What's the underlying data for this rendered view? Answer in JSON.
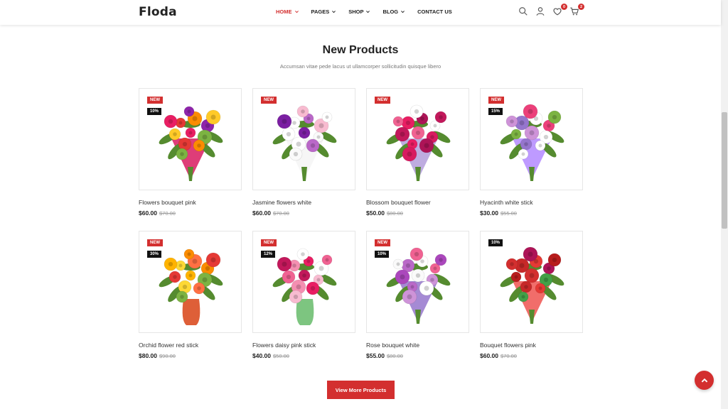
{
  "header": {
    "logo": "Floda",
    "nav": [
      {
        "label": "HOME",
        "active": true,
        "dropdown": true
      },
      {
        "label": "PAGES",
        "active": false,
        "dropdown": true
      },
      {
        "label": "SHOP",
        "active": false,
        "dropdown": true
      },
      {
        "label": "BLOG",
        "active": false,
        "dropdown": true
      },
      {
        "label": "CONTACT US",
        "active": false,
        "dropdown": false
      }
    ],
    "icons": [
      "search-icon",
      "user-icon",
      "heart-icon",
      "cart-icon"
    ],
    "wishlist_count": "0",
    "cart_count": "2"
  },
  "section": {
    "title": "New Products",
    "subtitle": "Accumsan vitae pede lacus ut ullamcorper sollicitudin quisque libero"
  },
  "products": [
    {
      "name": "Flowers bouquet pink",
      "price": "$60.00",
      "old_price": "$70.00",
      "new_tag": "NEW",
      "discount": "10%"
    },
    {
      "name": "Jasmine flowers white",
      "price": "$60.00",
      "old_price": "$70.00",
      "new_tag": "NEW",
      "discount": ""
    },
    {
      "name": "Blossom bouquet flower",
      "price": "$50.00",
      "old_price": "$80.00",
      "new_tag": "NEW",
      "discount": ""
    },
    {
      "name": "Hyacinth white stick",
      "price": "$30.00",
      "old_price": "$55.00",
      "new_tag": "NEW",
      "discount": "15%"
    },
    {
      "name": "Orchid flower red stick",
      "price": "$80.00",
      "old_price": "$90.00",
      "new_tag": "NEW",
      "discount": "30%"
    },
    {
      "name": "Flowers daisy pink stick",
      "price": "$40.00",
      "old_price": "$50.00",
      "new_tag": "NEW",
      "discount": "12%"
    },
    {
      "name": "Rose bouquet white",
      "price": "$55.00",
      "old_price": "$80.00",
      "new_tag": "NEW",
      "discount": "10%"
    },
    {
      "name": "Bouquet flowers pink",
      "price": "$60.00",
      "old_price": "$70.00",
      "new_tag": "",
      "discount": "10%"
    }
  ],
  "view_more_label": "View More Products",
  "colors": {
    "accent": "#d32f2f",
    "text": "#222222",
    "muted": "#777777"
  }
}
